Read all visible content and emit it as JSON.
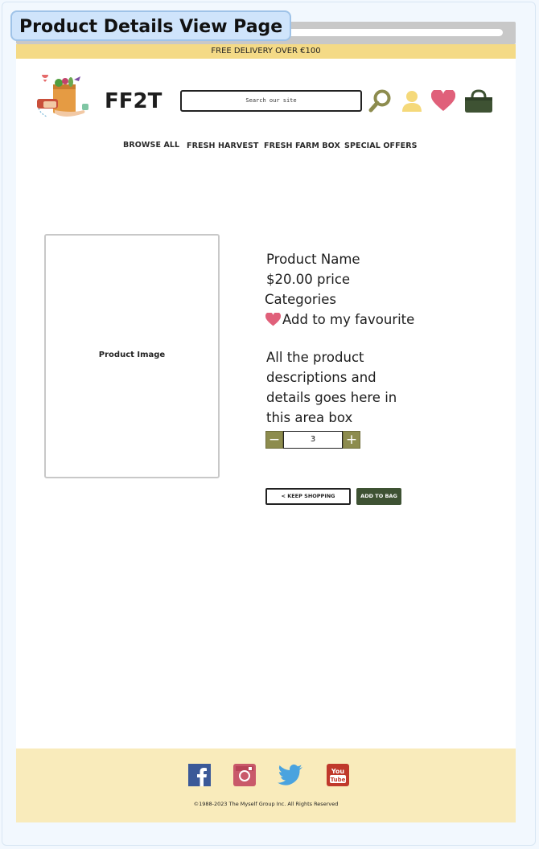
{
  "page_label": "Product Details View Page",
  "promo_banner": "FREE DELIVERY OVER €100",
  "header": {
    "brand": "FF2T",
    "search_placeholder": "Search our site",
    "icons": [
      "search-icon",
      "user-icon",
      "heart-icon",
      "shopping-bag-icon"
    ]
  },
  "nav": {
    "items": [
      {
        "label": "BROWSE ALL"
      },
      {
        "label": "FRESH HARVEST"
      },
      {
        "label": "FRESH FARM BOX"
      },
      {
        "label": "SPECIAL OFFERS"
      }
    ]
  },
  "product": {
    "image_label": "Product Image",
    "name": "Product Name",
    "price": "$20.00 price",
    "categories": "Categories",
    "favourite_label": "Add to my favourite",
    "description_lines": [
      "All the product",
      "descriptions and",
      "details goes here in",
      "this area box"
    ],
    "quantity": "3",
    "decrement_label": "−",
    "increment_label": "+"
  },
  "actions": {
    "keep_shopping": "< KEEP SHOPPING",
    "add_to_bag": "ADD TO BAG"
  },
  "footer": {
    "social_icons": [
      "facebook-icon",
      "instagram-icon",
      "twitter-icon",
      "youtube-icon"
    ],
    "copyright": "©1988-2023 The Myself Group Inc. All Rights Reserved"
  },
  "colors": {
    "promo_bg": "#f4da86",
    "footer_bg": "#f9ebbb",
    "accent_olive": "#8d8c4e",
    "heart_pink": "#e0607a",
    "bag_dark_green": "#3e5233",
    "user_yellow": "#f5d97a"
  }
}
